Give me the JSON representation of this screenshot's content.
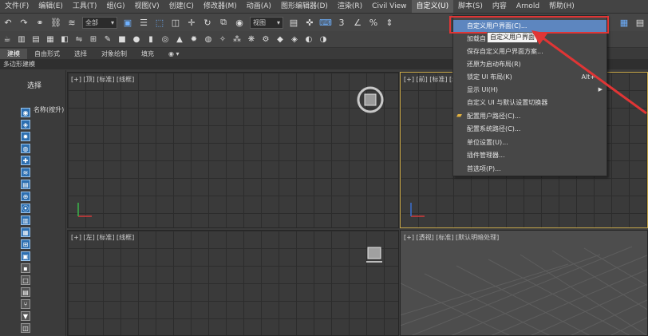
{
  "menubar": {
    "items": [
      "文件(F)",
      "编辑(E)",
      "工具(T)",
      "组(G)",
      "视图(V)",
      "创建(C)",
      "修改器(M)",
      "动画(A)",
      "图形编辑器(D)",
      "渲染(R)",
      "Civil View",
      "自定义(U)",
      "脚本(S)",
      "内容",
      "Arnold",
      "帮助(H)"
    ],
    "active_index": 11
  },
  "toolbar": {
    "selection_filter": "全部",
    "ref_coord": "视图",
    "icons": [
      "undo-icon",
      "redo-icon",
      "link-icon",
      "unlink-icon",
      "bind-spacewarp-icon",
      "select-object-icon",
      "select-by-name-icon",
      "rect-selection-icon",
      "window-crossing-icon",
      "move-icon",
      "rotate-icon",
      "scale-icon",
      "place-icon",
      "use-pivot-icon",
      "select-manipulate-icon",
      "keyboard-shortcut-icon",
      "snap-3d-icon",
      "angle-snap-icon",
      "percent-snap-icon",
      "spinner-snap-icon"
    ]
  },
  "ribbon": {
    "tabs": [
      "建模",
      "自由形式",
      "选择",
      "对象绘制",
      "填充"
    ],
    "active_tab": 0,
    "sub_label": "多边形建模"
  },
  "scene_explorer": {
    "select_label": "选择",
    "name_header": "名称(按升)"
  },
  "viewports": {
    "top": "[+] [顶] [标准] [线框]",
    "front": "[+] [前] [标准] [线框]",
    "left": "[+] [左] [标准] [线框]",
    "perspective": "[+] [透视] [标准] [默认明暗处理]"
  },
  "dropdown": {
    "items": [
      {
        "label": "自定义用户界面(C)...",
        "highlighted": true
      },
      {
        "label": "加载自"
      },
      {
        "label": "保存自定义用户界面方案..."
      },
      {
        "label": "还原为启动布局(R)"
      },
      {
        "label": "锁定 UI 布局(K)",
        "shortcut": "Alt+"
      },
      {
        "label": "显示 UI(H)",
        "submenu": true
      },
      {
        "label": "自定义 UI 与默认设置切换器"
      },
      {
        "label": "配置用户路径(C)..."
      },
      {
        "label": "配置系统路径(C)..."
      },
      {
        "label": "单位设置(U)..."
      },
      {
        "label": "插件管理器..."
      },
      {
        "label": "首选项(P)..."
      }
    ]
  },
  "tooltip": "自定义用户界面",
  "colors": {
    "highlight_outline": "#e03535",
    "menu_highlight": "#5d86bf",
    "annotation_arrow": "#e03535"
  }
}
